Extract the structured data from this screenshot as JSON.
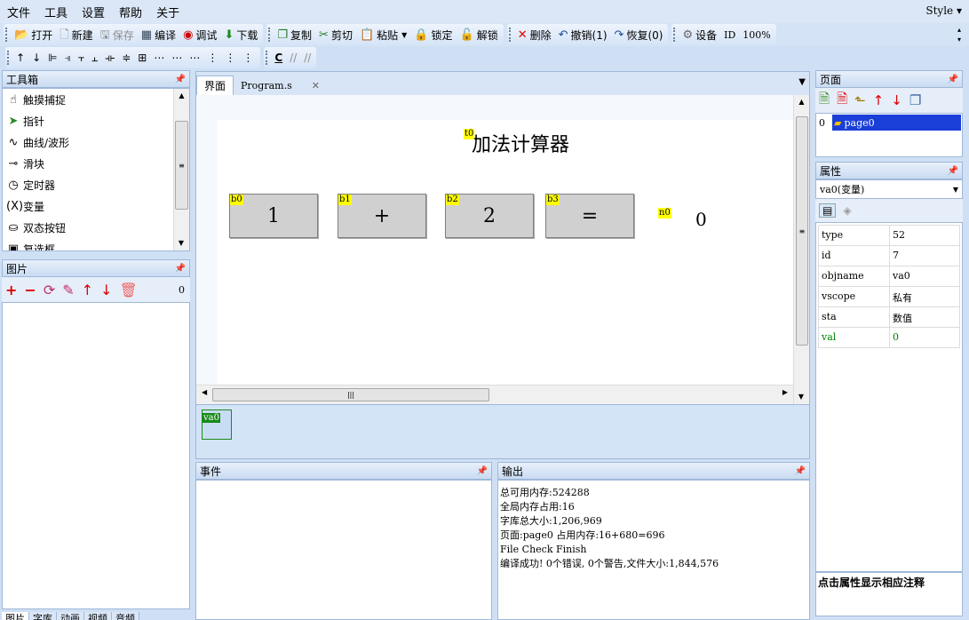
{
  "menu": [
    "文件",
    "工具",
    "设置",
    "帮助",
    "关于"
  ],
  "style_label": "Style ▾",
  "toolbar1": {
    "open": "打开",
    "new": "新建",
    "save": "保存",
    "compile": "编译",
    "debug": "调试",
    "download": "下载",
    "copy": "复制",
    "cut": "剪切",
    "paste": "粘贴",
    "lock": "锁定",
    "unlock": "解锁",
    "delete": "删除",
    "undo": "撤销(1)",
    "redo": "恢复(0)",
    "settings": "设备",
    "id": "ID",
    "zoom": "100%"
  },
  "toolbar2_extra": "C",
  "toolbox": {
    "title": "工具箱",
    "items": [
      {
        "label": "触摸捕捉",
        "icon": "hand-icon",
        "glyph": "☝"
      },
      {
        "label": "指针",
        "icon": "pointer-icon",
        "glyph": "➤"
      },
      {
        "label": "曲线/波形",
        "icon": "wave-icon",
        "glyph": "∿"
      },
      {
        "label": "滑块",
        "icon": "slider-icon",
        "glyph": "⊸"
      },
      {
        "label": "定时器",
        "icon": "clock-icon",
        "glyph": "◷"
      },
      {
        "label": "变量",
        "icon": "variable-icon",
        "glyph": "(X)"
      },
      {
        "label": "双态按钮",
        "icon": "toggle-icon",
        "glyph": "⛀"
      },
      {
        "label": "复选框",
        "icon": "checkbox-icon",
        "glyph": "▣"
      }
    ]
  },
  "pictures": {
    "title": "图片",
    "count": "0"
  },
  "bottom_tabs": [
    "图片",
    "字库",
    "动画",
    "视频",
    "音频"
  ],
  "editor": {
    "tabs": [
      {
        "label": "界面"
      },
      {
        "label": "Program.s"
      }
    ],
    "page_title": "加法计算器",
    "title_tag": "t0",
    "buttons": [
      {
        "tag": "b0",
        "text": "1"
      },
      {
        "tag": "b1",
        "text": "+"
      },
      {
        "tag": "b2",
        "text": "2"
      },
      {
        "tag": "b3",
        "text": "="
      }
    ],
    "number_tag": "n0",
    "number_value": "0"
  },
  "var_strip": {
    "item": "va0"
  },
  "events": {
    "title": "事件"
  },
  "output": {
    "title": "输出",
    "lines": [
      "总可用内存:524288",
      "全局内存占用:16",
      "字库总大小:1,206,969",
      "页面:page0 占用内存:16+680=696",
      "File Check Finish",
      "编译成功! 0个错误, 0个警告,文件大小:1,844,576"
    ]
  },
  "pages": {
    "title": "页面",
    "index": "0",
    "page_name": "page0"
  },
  "properties": {
    "title": "属性",
    "selected": "va0(变量)",
    "rows": [
      {
        "k": "type",
        "v": "52",
        "green": false
      },
      {
        "k": "id",
        "v": "7",
        "green": false
      },
      {
        "k": "objname",
        "v": "va0",
        "green": false
      },
      {
        "k": "vscope",
        "v": "私有",
        "green": false
      },
      {
        "k": "sta",
        "v": "数值",
        "green": false
      },
      {
        "k": "val",
        "v": "0",
        "green": true
      }
    ],
    "hint": "点击属性显示相应注释"
  }
}
